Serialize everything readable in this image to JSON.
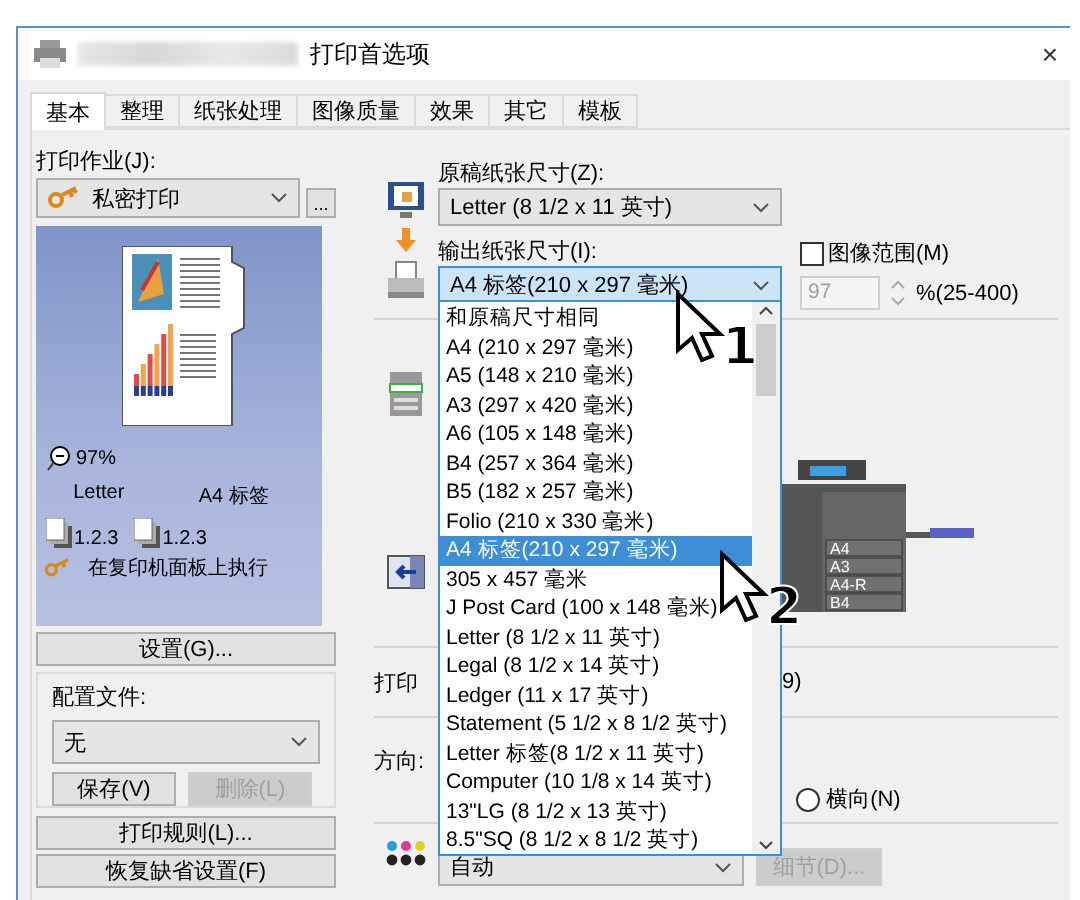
{
  "window": {
    "title": "打印首选项",
    "close": "×"
  },
  "tabs": [
    {
      "label": "基本",
      "selected": true
    },
    {
      "label": "整理",
      "selected": false
    },
    {
      "label": "纸张处理",
      "selected": false
    },
    {
      "label": "图像质量",
      "selected": false
    },
    {
      "label": "效果",
      "selected": false
    },
    {
      "label": "其它",
      "selected": false
    },
    {
      "label": "模板",
      "selected": false
    }
  ],
  "print_job": {
    "label": "打印作业(J):",
    "value": "私密打印",
    "more": "..."
  },
  "preview": {
    "zoom": "97%",
    "original_size": "Letter",
    "output_size": "A4 标签",
    "original_order": "1.2.3",
    "output_order": "1.2.3",
    "job_note": "在复印机面板上执行"
  },
  "settings_button": "设置(G)...",
  "profile": {
    "label": "配置文件:",
    "value": "无",
    "buttons": [
      {
        "label": "保存(V)",
        "disabled": false
      },
      {
        "label": "删除(L)",
        "disabled": true
      }
    ]
  },
  "bottom_buttons": [
    "打印规则(L)...",
    "恢复缺省设置(F)"
  ],
  "original_size": {
    "label": "原稿纸张尺寸(Z):",
    "value": "Letter (8 1/2 x 11 英寸)"
  },
  "output_size": {
    "label": "输出纸张尺寸(I):",
    "value": "A4 标签(210 x 297 毫米)",
    "expanded": true,
    "options": [
      {
        "label": "和原稿尺寸相同",
        "selected": false
      },
      {
        "label": "A4 (210 x 297 毫米)",
        "selected": false
      },
      {
        "label": "A5 (148 x 210 毫米)",
        "selected": false
      },
      {
        "label": "A3 (297 x 420 毫米)",
        "selected": false
      },
      {
        "label": "A6 (105 x 148 毫米)",
        "selected": false
      },
      {
        "label": "B4 (257 x 364 毫米)",
        "selected": false
      },
      {
        "label": "B5 (182 x 257 毫米)",
        "selected": false
      },
      {
        "label": "Folio (210 x 330 毫米)",
        "selected": false
      },
      {
        "label": "A4 标签(210 x 297 毫米)",
        "selected": true
      },
      {
        "label": "305 x 457 毫米",
        "selected": false
      },
      {
        "label": "J Post Card (100 x 148 毫米)",
        "selected": false
      },
      {
        "label": "Letter (8 1/2 x 11 英寸)",
        "selected": false
      },
      {
        "label": "Legal (8 1/2 x 14 英寸)",
        "selected": false
      },
      {
        "label": "Ledger (11 x 17 英寸)",
        "selected": false
      },
      {
        "label": "Statement (5 1/2 x 8 1/2 英寸)",
        "selected": false
      },
      {
        "label": "Letter 标签(8 1/2 x 11 英寸)",
        "selected": false
      },
      {
        "label": "Computer (10 1/8 x 14 英寸)",
        "selected": false
      },
      {
        "label": "13\"LG (8 1/2 x 13 英寸)",
        "selected": false
      },
      {
        "label": "8.5\"SQ (8 1/2 x 8 1/2 英寸)",
        "selected": false
      }
    ]
  },
  "image_range": {
    "label": "图像范围(M)",
    "checked": false,
    "value": "97",
    "range": "%(25-400)",
    "disabled": true
  },
  "trays": [
    "A4",
    "A3",
    "A4-R",
    "B4"
  ],
  "copies": {
    "label": "打印",
    "value": "9)"
  },
  "orientation": {
    "label": "方向:",
    "options": [
      {
        "label": "横向(N)",
        "selected": false
      }
    ]
  },
  "color": {
    "value": "自动",
    "details": {
      "label": "细节(D)...",
      "disabled": true
    }
  },
  "callouts": [
    "1",
    "2"
  ]
}
